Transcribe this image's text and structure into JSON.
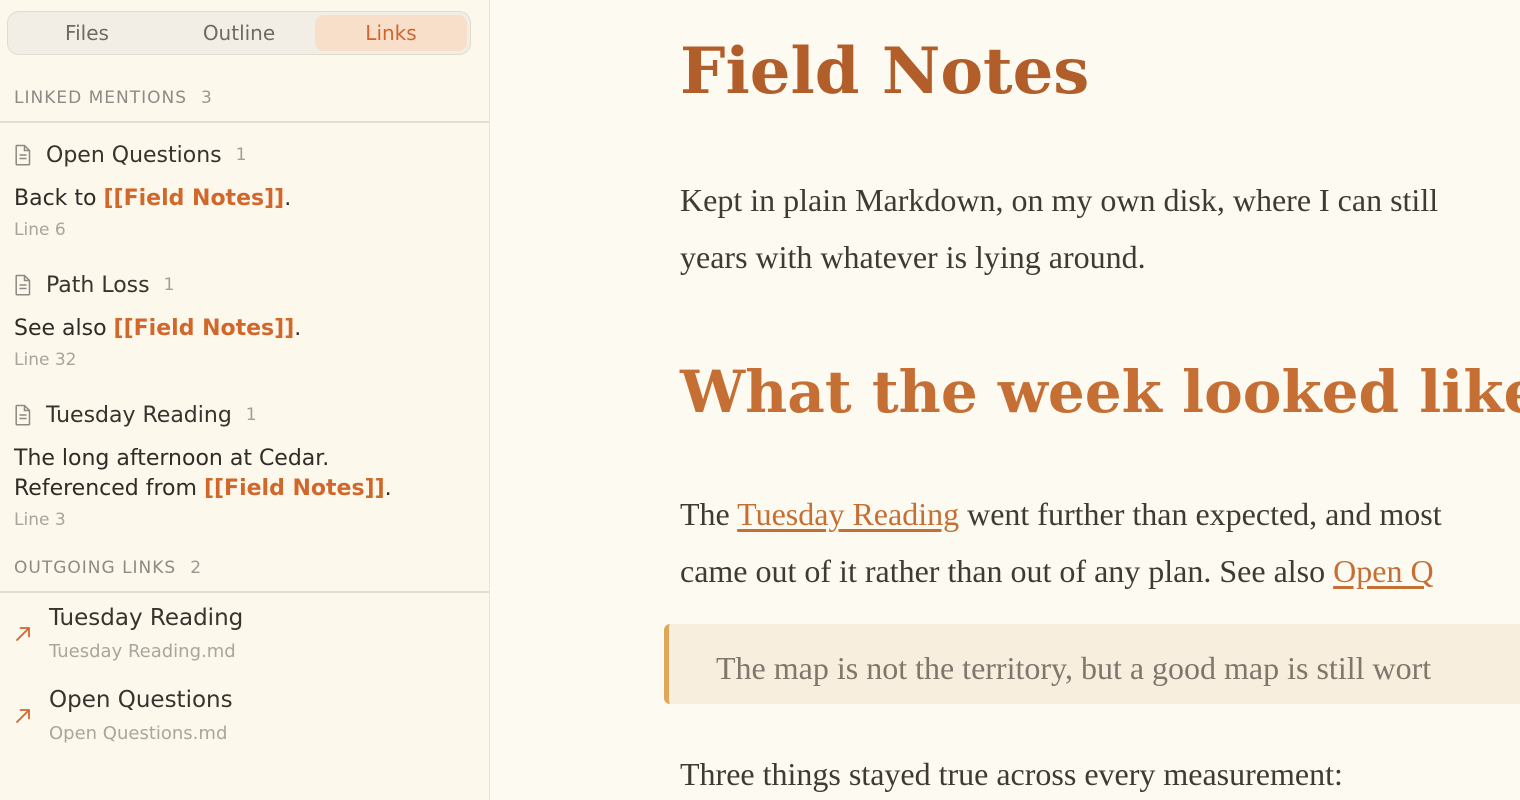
{
  "tabs": [
    "Files",
    "Outline",
    "Links"
  ],
  "active_tab": "Links",
  "linked_mentions": {
    "heading": "LINKED MENTIONS",
    "count": "3",
    "items": [
      {
        "title": "Open Questions",
        "count": "1",
        "pre": "Back to ",
        "link": "[[Field Notes]]",
        "post": ".",
        "line": "Line 6"
      },
      {
        "title": "Path Loss",
        "count": "1",
        "pre": "See also ",
        "link": "[[Field Notes]]",
        "post": ".",
        "line": "Line 32"
      },
      {
        "title": "Tuesday Reading",
        "count": "1",
        "line1": "The long afternoon at Cedar.",
        "pre": "Referenced from ",
        "link": "[[Field Notes]]",
        "post": ".",
        "line": "Line 3"
      }
    ]
  },
  "outgoing_links": {
    "heading": "OUTGOING LINKS",
    "count": "2",
    "items": [
      {
        "title": "Tuesday Reading",
        "file": "Tuesday Reading.md"
      },
      {
        "title": "Open Questions",
        "file": "Open Questions.md"
      }
    ]
  },
  "document": {
    "title": "Field Notes",
    "intro_line1": "Kept in plain Markdown, on my own disk, where I can still",
    "intro_line2": "years with whatever is lying around.",
    "heading2": "What the week looked like",
    "para_line1_pre": "The ",
    "para_line1_link": "Tuesday Reading",
    "para_line1_post": " went further than expected, and most",
    "para_line2_pre": "came out of it rather than out of any plan. See also ",
    "para_line2_link": "Open Q",
    "quote": "The map is not the territory, but a good map is still wort",
    "last_line": "Three things stayed true across every measurement:"
  },
  "colors": {
    "accent": "#c56f34",
    "wikilink": "#d2672c",
    "background": "#fdfaf1"
  },
  "icons": {
    "mention": "document-icon",
    "outgoing": "arrow-up-right-icon"
  }
}
